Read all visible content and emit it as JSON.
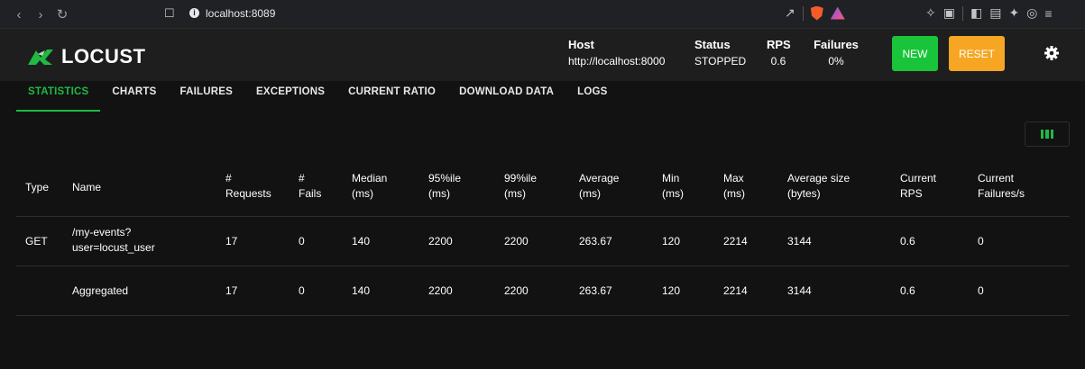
{
  "browser": {
    "url": "localhost:8089"
  },
  "app": {
    "logo_text": "LOCUST",
    "host_label": "Host",
    "host_value": "http://localhost:8000",
    "status_label": "Status",
    "status_value": "STOPPED",
    "rps_label": "RPS",
    "rps_value": "0.6",
    "failures_label": "Failures",
    "failures_value": "0%",
    "new_label": "NEW",
    "reset_label": "RESET"
  },
  "tabs": [
    "STATISTICS",
    "CHARTS",
    "FAILURES",
    "EXCEPTIONS",
    "CURRENT RATIO",
    "DOWNLOAD DATA",
    "LOGS"
  ],
  "table": {
    "headers": [
      [
        "Type"
      ],
      [
        "Name"
      ],
      [
        "#",
        "Requests"
      ],
      [
        "#",
        "Fails"
      ],
      [
        "Median",
        "(ms)"
      ],
      [
        "95%ile",
        "(ms)"
      ],
      [
        "99%ile",
        "(ms)"
      ],
      [
        "Average",
        "(ms)"
      ],
      [
        "Min",
        "(ms)"
      ],
      [
        "Max",
        "(ms)"
      ],
      [
        "Average size",
        "(bytes)"
      ],
      [
        "Current",
        "RPS"
      ],
      [
        "Current",
        "Failures/s"
      ]
    ],
    "rows": [
      {
        "type": "GET",
        "name": [
          "/my-events?",
          "user=locust_user"
        ],
        "requests": "17",
        "fails": "0",
        "median": "140",
        "p95": "2200",
        "p99": "2200",
        "average": "263.67",
        "min": "120",
        "max": "2214",
        "avg_size": "3144",
        "rps": "0.6",
        "failures_s": "0"
      },
      {
        "type": "",
        "name": [
          "Aggregated"
        ],
        "requests": "17",
        "fails": "0",
        "median": "140",
        "p95": "2200",
        "p99": "2200",
        "average": "263.67",
        "min": "120",
        "max": "2214",
        "avg_size": "3144",
        "rps": "0.6",
        "failures_s": "0"
      }
    ]
  },
  "colors": {
    "accent": "#1fb944",
    "new_button": "#19c43a",
    "reset_button": "#f6a623"
  }
}
